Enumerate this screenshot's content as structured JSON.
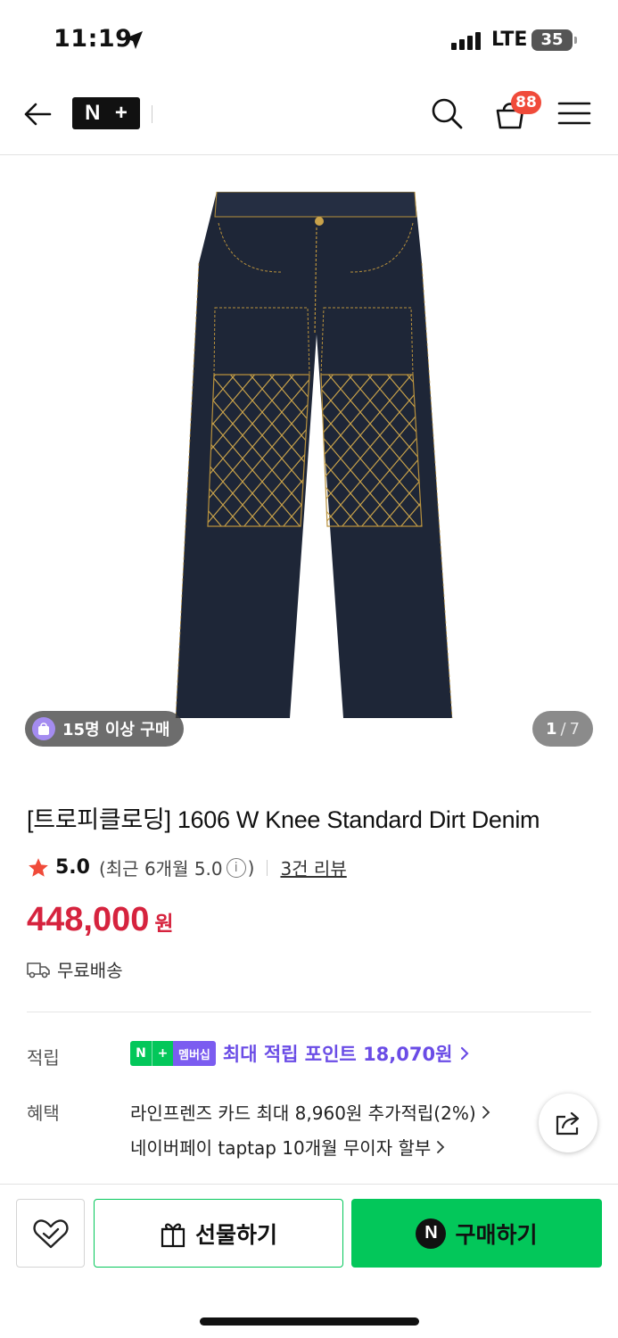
{
  "status_bar": {
    "time": "11:19",
    "network": "LTE",
    "battery": "35"
  },
  "header": {
    "logo_left": "N",
    "logo_right": "+",
    "cart_count": "88",
    "icons": [
      "back-arrow-icon",
      "search-icon",
      "cart-icon",
      "hamburger-menu-icon"
    ]
  },
  "gallery": {
    "buyers_badge": "15명 이상 구매",
    "page_current": "1",
    "page_separator": "/",
    "page_total": "7"
  },
  "product": {
    "title": "[트로피클로딩] 1606 W Knee Standard Dirt Denim",
    "rating_score": "5.0",
    "rating_recent_prefix": "(최근 6개월 5.0",
    "rating_info": "i",
    "rating_recent_suffix": ")",
    "review_link": "3건 리뷰",
    "price": "448,000",
    "currency": "원",
    "shipping": "무료배송"
  },
  "points": {
    "label": "적립",
    "badge_n": "N",
    "badge_plus": "+",
    "badge_membership": "멤버십",
    "text": "최대 적립 포인트 18,070원"
  },
  "benefits": {
    "label": "혜택",
    "items": [
      "라인프렌즈 카드 최대 8,960원 추가적립(2%)",
      "네이버페이 taptap 10개월 무이자 할부"
    ]
  },
  "bottom_bar": {
    "gift_label": "선물하기",
    "buy_mark": "N",
    "buy_label": "구매하기"
  },
  "colors": {
    "price_red": "#d6233e",
    "naver_green": "#03c75a",
    "membership_purple": "#6a4ce6",
    "cart_badge_red": "#f04b3a"
  }
}
